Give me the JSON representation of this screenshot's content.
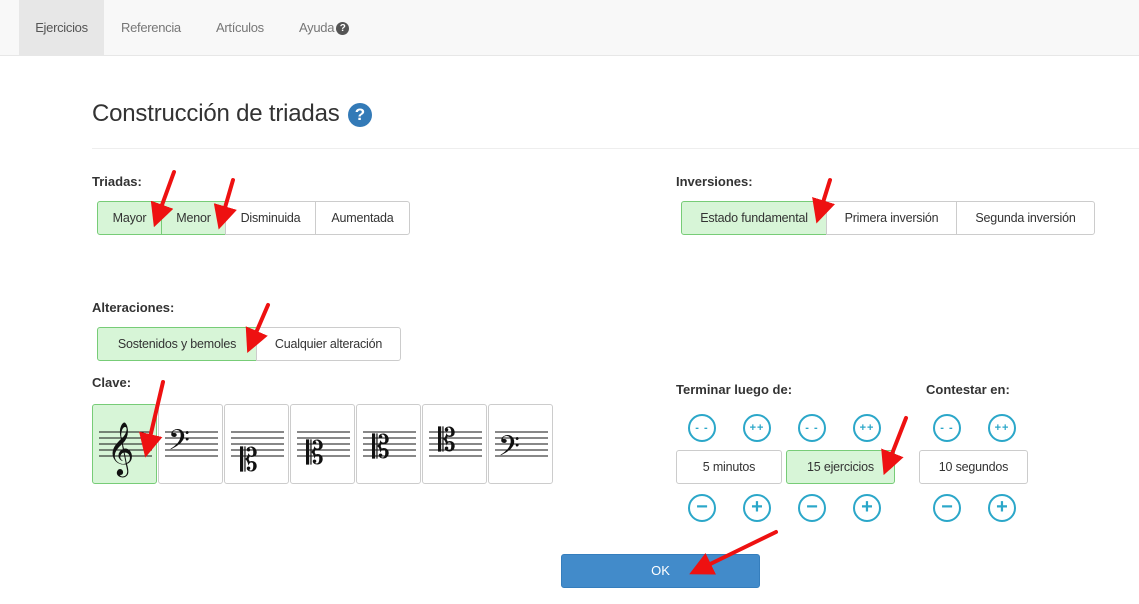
{
  "nav": {
    "items": [
      {
        "label": "Ejercicios",
        "active": true
      },
      {
        "label": "Referencia",
        "active": false
      },
      {
        "label": "Artículos",
        "active": false
      },
      {
        "label": "Ayuda",
        "active": false
      }
    ]
  },
  "title": "Construcción de triadas",
  "title_help_icon": "?",
  "triadas": {
    "label": "Triadas:",
    "options": [
      {
        "label": "Mayor",
        "selected": true
      },
      {
        "label": "Menor",
        "selected": true
      },
      {
        "label": "Disminuida",
        "selected": false
      },
      {
        "label": "Aumentada",
        "selected": false
      }
    ]
  },
  "inversiones": {
    "label": "Inversiones:",
    "options": [
      {
        "label": "Estado fundamental",
        "selected": true
      },
      {
        "label": "Primera inversión",
        "selected": false
      },
      {
        "label": "Segunda inversión",
        "selected": false
      }
    ]
  },
  "alteraciones": {
    "label": "Alteraciones:",
    "options": [
      {
        "label": "Sostenidos y bemoles",
        "selected": true
      },
      {
        "label": "Cualquier alteración",
        "selected": false
      }
    ]
  },
  "clave": {
    "label": "Clave:",
    "options": [
      {
        "icon": "treble-clef-icon",
        "selected": true
      },
      {
        "icon": "bass-clef-icon",
        "selected": false
      },
      {
        "icon": "c-clef-low-icon",
        "selected": false
      },
      {
        "icon": "c-clef-mid-icon",
        "selected": false
      },
      {
        "icon": "c-clef-upper-icon",
        "selected": false
      },
      {
        "icon": "c-clef-high-icon",
        "selected": false
      },
      {
        "icon": "baritone-clef-icon",
        "selected": false
      }
    ]
  },
  "terminar": {
    "label": "Terminar luego de:",
    "minutes": {
      "value": "5 minutos",
      "selected": false
    },
    "exercises": {
      "value": "15 ejercicios",
      "selected": true
    }
  },
  "contestar": {
    "label": "Contestar en:",
    "seconds": {
      "value": "10 segundos",
      "selected": false
    }
  },
  "steppers": {
    "dec_big": "- -",
    "inc_big": "++",
    "dec": "−",
    "inc": "+"
  },
  "ok_label": "OK",
  "colors": {
    "selected_bg": "#d7f5d7",
    "selected_border": "#77cc77",
    "stepper": "#2ba7c9",
    "ok_button": "#428bca",
    "annotation_arrow": "#ee1111"
  }
}
